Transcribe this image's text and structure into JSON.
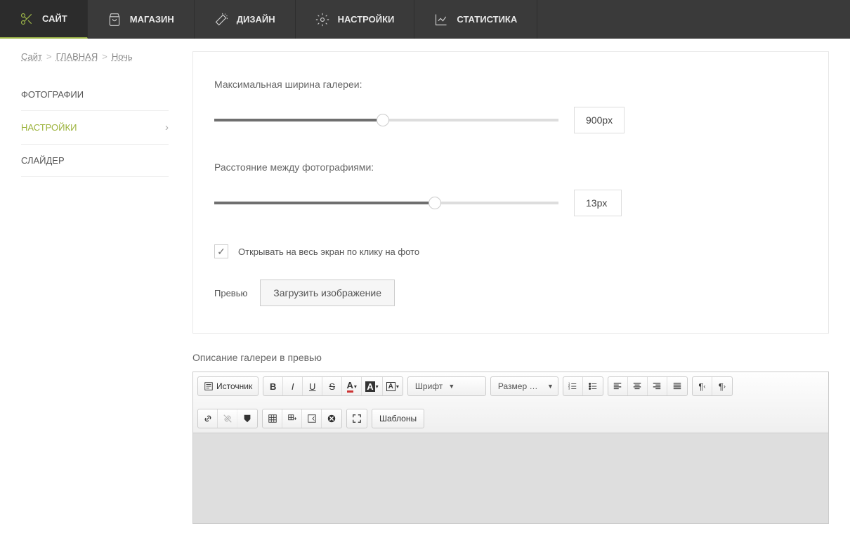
{
  "topnav": [
    {
      "key": "site",
      "label": "САЙТ",
      "icon": "scissors",
      "active": true
    },
    {
      "key": "shop",
      "label": "МАГАЗИН",
      "icon": "bag",
      "active": false
    },
    {
      "key": "design",
      "label": "ДИЗАЙН",
      "icon": "wand",
      "active": false
    },
    {
      "key": "settings",
      "label": "НАСТРОЙКИ",
      "icon": "gear",
      "active": false
    },
    {
      "key": "stats",
      "label": "СТАТИСТИКА",
      "icon": "chart",
      "active": false
    }
  ],
  "breadcrumb": [
    "Сайт",
    "ГЛАВНАЯ",
    "Ночь"
  ],
  "sidebar": [
    {
      "key": "photos",
      "label": "ФОТОГРАФИИ",
      "active": false
    },
    {
      "key": "settings",
      "label": "НАСТРОЙКИ",
      "active": true
    },
    {
      "key": "slider",
      "label": "СЛАЙДЕР",
      "active": false
    }
  ],
  "settings": {
    "maxWidthLabel": "Максимальная ширина галереи:",
    "maxWidthValue": "900px",
    "maxWidthPct": 49,
    "gapLabel": "Расстояние между фотографиями:",
    "gapValue": "13px",
    "gapPct": 64,
    "fullscreenLabel": "Открывать на весь экран по клику на фото",
    "fullscreenChecked": true,
    "previewLabel": "Превью",
    "uploadBtn": "Загрузить изображение"
  },
  "desc": {
    "title": "Описание галереи в превью",
    "sourceBtn": "Источник",
    "fontLabel": "Шрифт",
    "sizeLabel": "Размер ш...",
    "templatesBtn": "Шаблоны"
  }
}
